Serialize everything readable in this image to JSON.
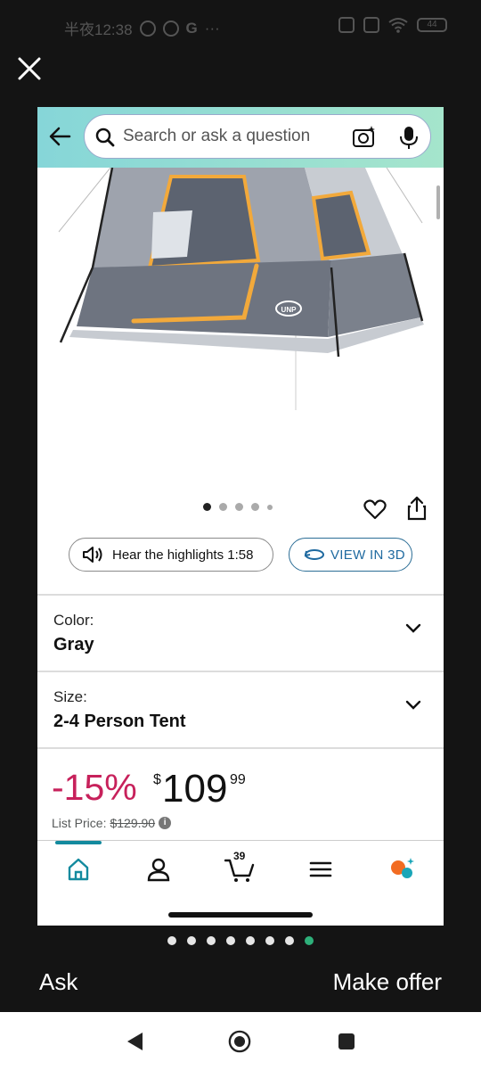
{
  "status_bar": {
    "time": "半夜12:38",
    "extras": "···",
    "battery": "44"
  },
  "search": {
    "placeholder": "Search or ask a question"
  },
  "gallery": {
    "image_count": 5,
    "active_index": 0
  },
  "media_buttons": {
    "highlights": "Hear the highlights 1:58",
    "view_3d": "VIEW IN 3D"
  },
  "variants": [
    {
      "label": "Color:",
      "value": "Gray"
    },
    {
      "label": "Size:",
      "value": "2-4 Person Tent"
    }
  ],
  "price": {
    "discount": "-15%",
    "currency": "$",
    "whole": "109",
    "fraction": "99",
    "list_label": "List Price:",
    "list_value": "$129.90"
  },
  "bottom_nav": {
    "cart_count": "39",
    "items": [
      "home-icon",
      "account-icon",
      "cart-icon",
      "menu-icon",
      "rufus-icon"
    ],
    "accent_color": "#138a9e"
  },
  "pager": {
    "count": 8,
    "active_index": 7,
    "active_color": "#2eb07a"
  },
  "actions": {
    "ask": "Ask",
    "make_offer": "Make offer"
  },
  "colors": {
    "discount": "#c7215b",
    "link_blue": "#1f6aa0",
    "tent_orange": "#f2a93b",
    "tent_gray": "#6e7480"
  }
}
